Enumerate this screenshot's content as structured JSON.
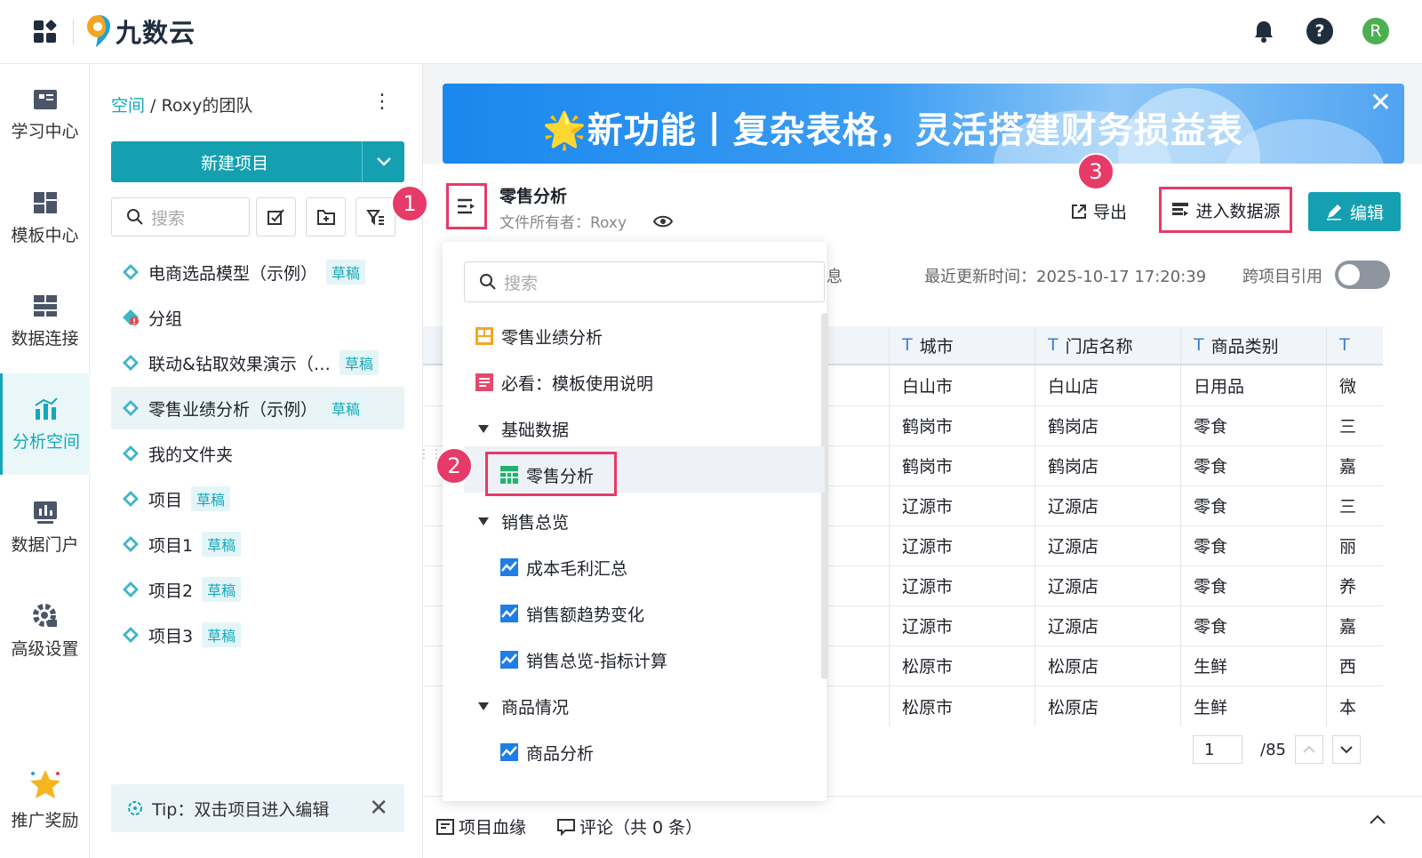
{
  "header": {
    "logo_text": "九数云",
    "avatar_letter": "R",
    "help_label": "?"
  },
  "sidebar": {
    "items": [
      {
        "label": "学习中心",
        "icon": "book-icon"
      },
      {
        "label": "模板中心",
        "icon": "template-icon"
      },
      {
        "label": "数据连接",
        "icon": "data-connect-icon"
      },
      {
        "label": "分析空间",
        "icon": "analysis-icon"
      },
      {
        "label": "数据门户",
        "icon": "portal-icon"
      },
      {
        "label": "高级设置",
        "icon": "gear-icon"
      },
      {
        "label": "推广奖励",
        "icon": "star-icon"
      }
    ]
  },
  "panel": {
    "breadcrumb_link": "空间",
    "breadcrumb_sep": " / ",
    "breadcrumb_current": "Roxy的团队",
    "new_project": "新建项目",
    "search_placeholder": "搜索",
    "projects": [
      {
        "name": "电商选品模型（示例）",
        "badge": "草稿"
      },
      {
        "name": "分组",
        "badge": ""
      },
      {
        "name": "联动&钻取效果演示（…",
        "badge": "草稿"
      },
      {
        "name": "零售业绩分析（示例）",
        "badge": "草稿"
      },
      {
        "name": "我的文件夹",
        "badge": ""
      },
      {
        "name": "项目",
        "badge": "草稿"
      },
      {
        "name": "项目1",
        "badge": "草稿"
      },
      {
        "name": "项目2",
        "badge": "草稿"
      },
      {
        "name": "项目3",
        "badge": "草稿"
      }
    ],
    "tip": "Tip：双击项目进入编辑"
  },
  "banner": {
    "title": "🌟新功能丨复杂表格，灵活搭建财务损益表"
  },
  "report": {
    "name": "零售分析",
    "owner": "文件所有者：Roxy",
    "export": "导出",
    "enter_datasource": "进入数据源",
    "edit": "编辑",
    "updated": "最近更新时间：2025-10-17 17:20:39",
    "cross_ref": "跨项目引用",
    "partial_tab": "息"
  },
  "markers": [
    "1",
    "2",
    "3"
  ],
  "dropdown": {
    "search_placeholder": "搜索",
    "items": [
      {
        "label": "零售业绩分析"
      },
      {
        "label": "必看：模板使用说明"
      },
      {
        "label": "基础数据"
      },
      {
        "label": "零售分析"
      },
      {
        "label": "销售总览"
      },
      {
        "label": "成本毛利汇总"
      },
      {
        "label": "销售额趋势变化"
      },
      {
        "label": "销售总览-指标计算"
      },
      {
        "label": "商品情况"
      },
      {
        "label": "商品分析"
      }
    ]
  },
  "table": {
    "columns": [
      "城市",
      "门店名称",
      "商品类别",
      ""
    ],
    "rows": [
      [
        "白山市",
        "白山店",
        "日用品",
        "微"
      ],
      [
        "鹤岗市",
        "鹤岗店",
        "零食",
        "三"
      ],
      [
        "鹤岗市",
        "鹤岗店",
        "零食",
        "嘉"
      ],
      [
        "辽源市",
        "辽源店",
        "零食",
        "三"
      ],
      [
        "辽源市",
        "辽源店",
        "零食",
        "丽"
      ],
      [
        "辽源市",
        "辽源店",
        "零食",
        "养"
      ],
      [
        "辽源市",
        "辽源店",
        "零食",
        "嘉"
      ],
      [
        "松原市",
        "松原店",
        "生鲜",
        "西"
      ],
      [
        "松原市",
        "松原店",
        "生鲜",
        "本"
      ]
    ]
  },
  "pager": {
    "page": "1",
    "total": "/85"
  },
  "footer": {
    "lineage": "项目血缘",
    "comments": "评论（共 0 条）"
  },
  "colors": {
    "accent": "#14a0b0",
    "highlight": "#e63a68"
  }
}
